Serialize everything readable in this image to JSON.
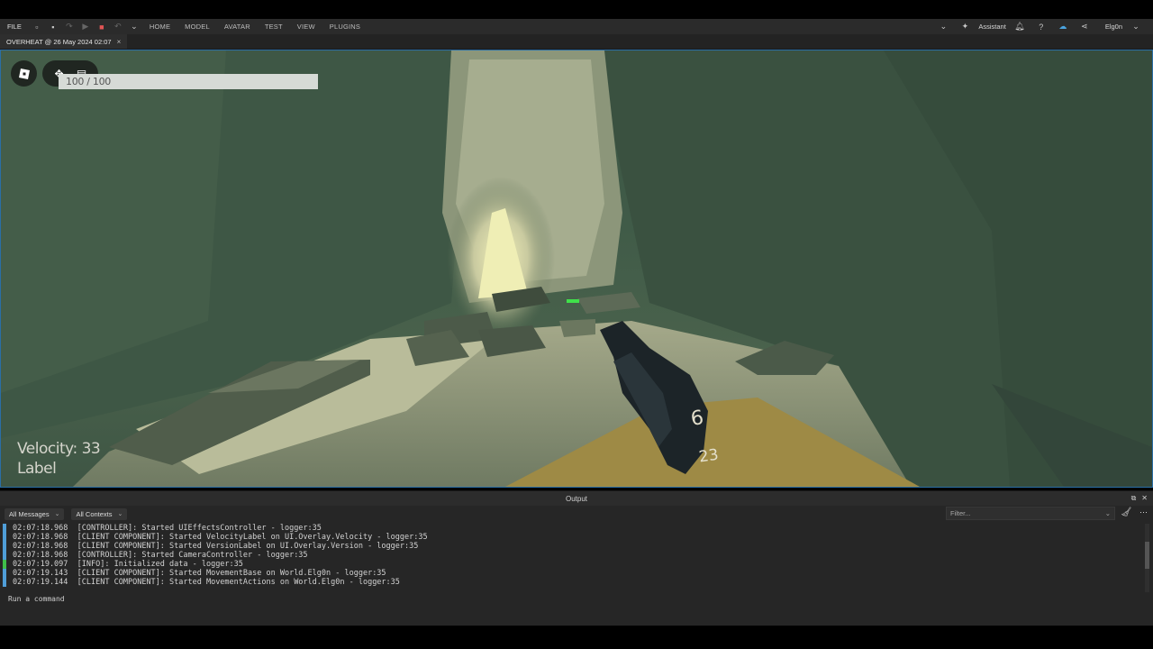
{
  "menubar": {
    "file_label": "FILE",
    "items": [
      "HOME",
      "MODEL",
      "AVATAR",
      "TEST",
      "VIEW",
      "PLUGINS"
    ],
    "assistant_label": "Assistant",
    "user_name": "Elg0n"
  },
  "tabs": [
    {
      "label": "OVERHEAT @ 26 May 2024 02:07",
      "close": "×"
    }
  ],
  "game_hud": {
    "health_text": "100 / 100",
    "velocity_text": "Velocity: 33",
    "label_text": "Label",
    "ammo_mag": "6",
    "ammo_reserve": "23"
  },
  "output": {
    "title": "Output",
    "message_filter": "All Messages",
    "context_filter": "All Contexts",
    "filter_placeholder": "Filter...",
    "command_placeholder": "Run a command",
    "logs": [
      {
        "time": "02:07:18.968",
        "text": "[CONTROLLER]: Started UIEffectsController - logger:35",
        "marker": "blue"
      },
      {
        "time": "02:07:18.968",
        "text": "[CLIENT COMPONENT]: Started VelocityLabel on UI.Overlay.Velocity - logger:35",
        "marker": "blue"
      },
      {
        "time": "02:07:18.968",
        "text": "[CLIENT COMPONENT]: Started VersionLabel on UI.Overlay.Version - logger:35",
        "marker": "blue"
      },
      {
        "time": "02:07:18.968",
        "text": "[CONTROLLER]: Started CameraController - logger:35",
        "marker": "blue"
      },
      {
        "time": "02:07:19.097",
        "text": "[INFO]: Initialized data - logger:35",
        "marker": "green"
      },
      {
        "time": "02:07:19.143",
        "text": "[CLIENT COMPONENT]: Started MovementBase on World.Elg0n - logger:35",
        "marker": "blue"
      },
      {
        "time": "02:07:19.144",
        "text": "[CLIENT COMPONENT]: Started MovementActions on World.Elg0n - logger:35",
        "marker": "blue"
      }
    ]
  },
  "colors": {
    "accent_blue": "#4f9ed8",
    "info_green": "#3fbf4a",
    "viewport_border": "#2a6ea6"
  }
}
